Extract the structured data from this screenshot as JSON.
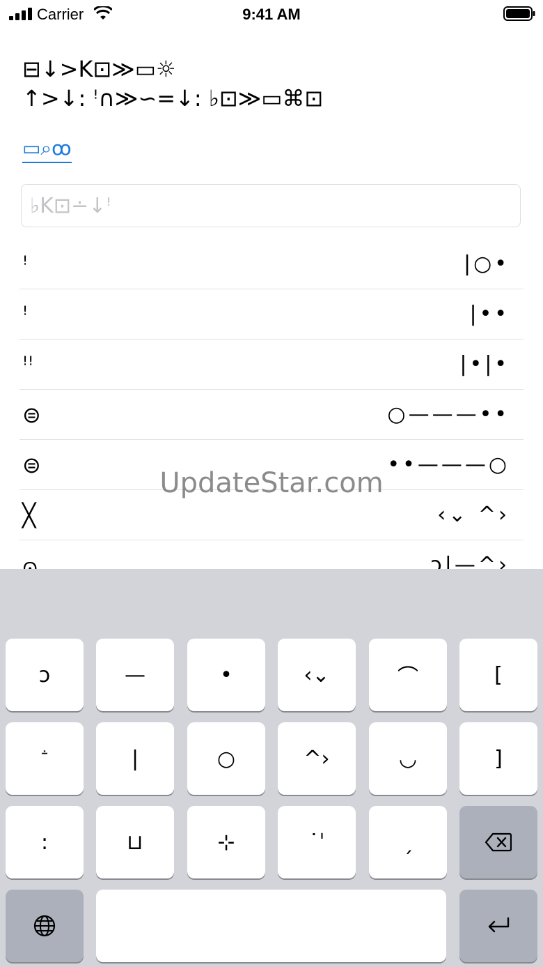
{
  "status_bar": {
    "carrier": "Carrier",
    "time": "9:41 AM"
  },
  "content": {
    "title_lines": [
      "⊟↓>K⊡≫▭☼",
      "↑>↓: ꜝ∩≫∽=↓: ♭⊡≫▭⌘⊡"
    ],
    "link_label": "▭⌕ꝏ",
    "search_placeholder": "♭K⊡∸↓ꜝ",
    "search_value": ""
  },
  "list": [
    {
      "symbol": "ꜝ",
      "code": "|○•"
    },
    {
      "symbol": "ꜝ",
      "code": "|••"
    },
    {
      "symbol": "ꜝꜝ",
      "code": "|•|•"
    },
    {
      "symbol": "⊜",
      "code": "○———••"
    },
    {
      "symbol": "⊜",
      "code": "••———○"
    },
    {
      "symbol": "╳",
      "code": "‹⌄ ^›"
    },
    {
      "symbol": "⩀",
      "code": "ↄ|—^›"
    }
  ],
  "watermark": "UpdateStar.com",
  "keyboard": {
    "row1": [
      "ↄ",
      "—",
      "•",
      "‹⌄",
      "⌒",
      "["
    ],
    "row2": [
      "ꜙ",
      "|",
      "○",
      "^›",
      "◡",
      "]"
    ],
    "row3": [
      ":",
      "⊔",
      "⊹",
      "˙ˈ",
      "ˏ"
    ],
    "icons": {
      "globe": "globe-icon",
      "delete": "delete-icon",
      "return": "return-icon"
    }
  }
}
